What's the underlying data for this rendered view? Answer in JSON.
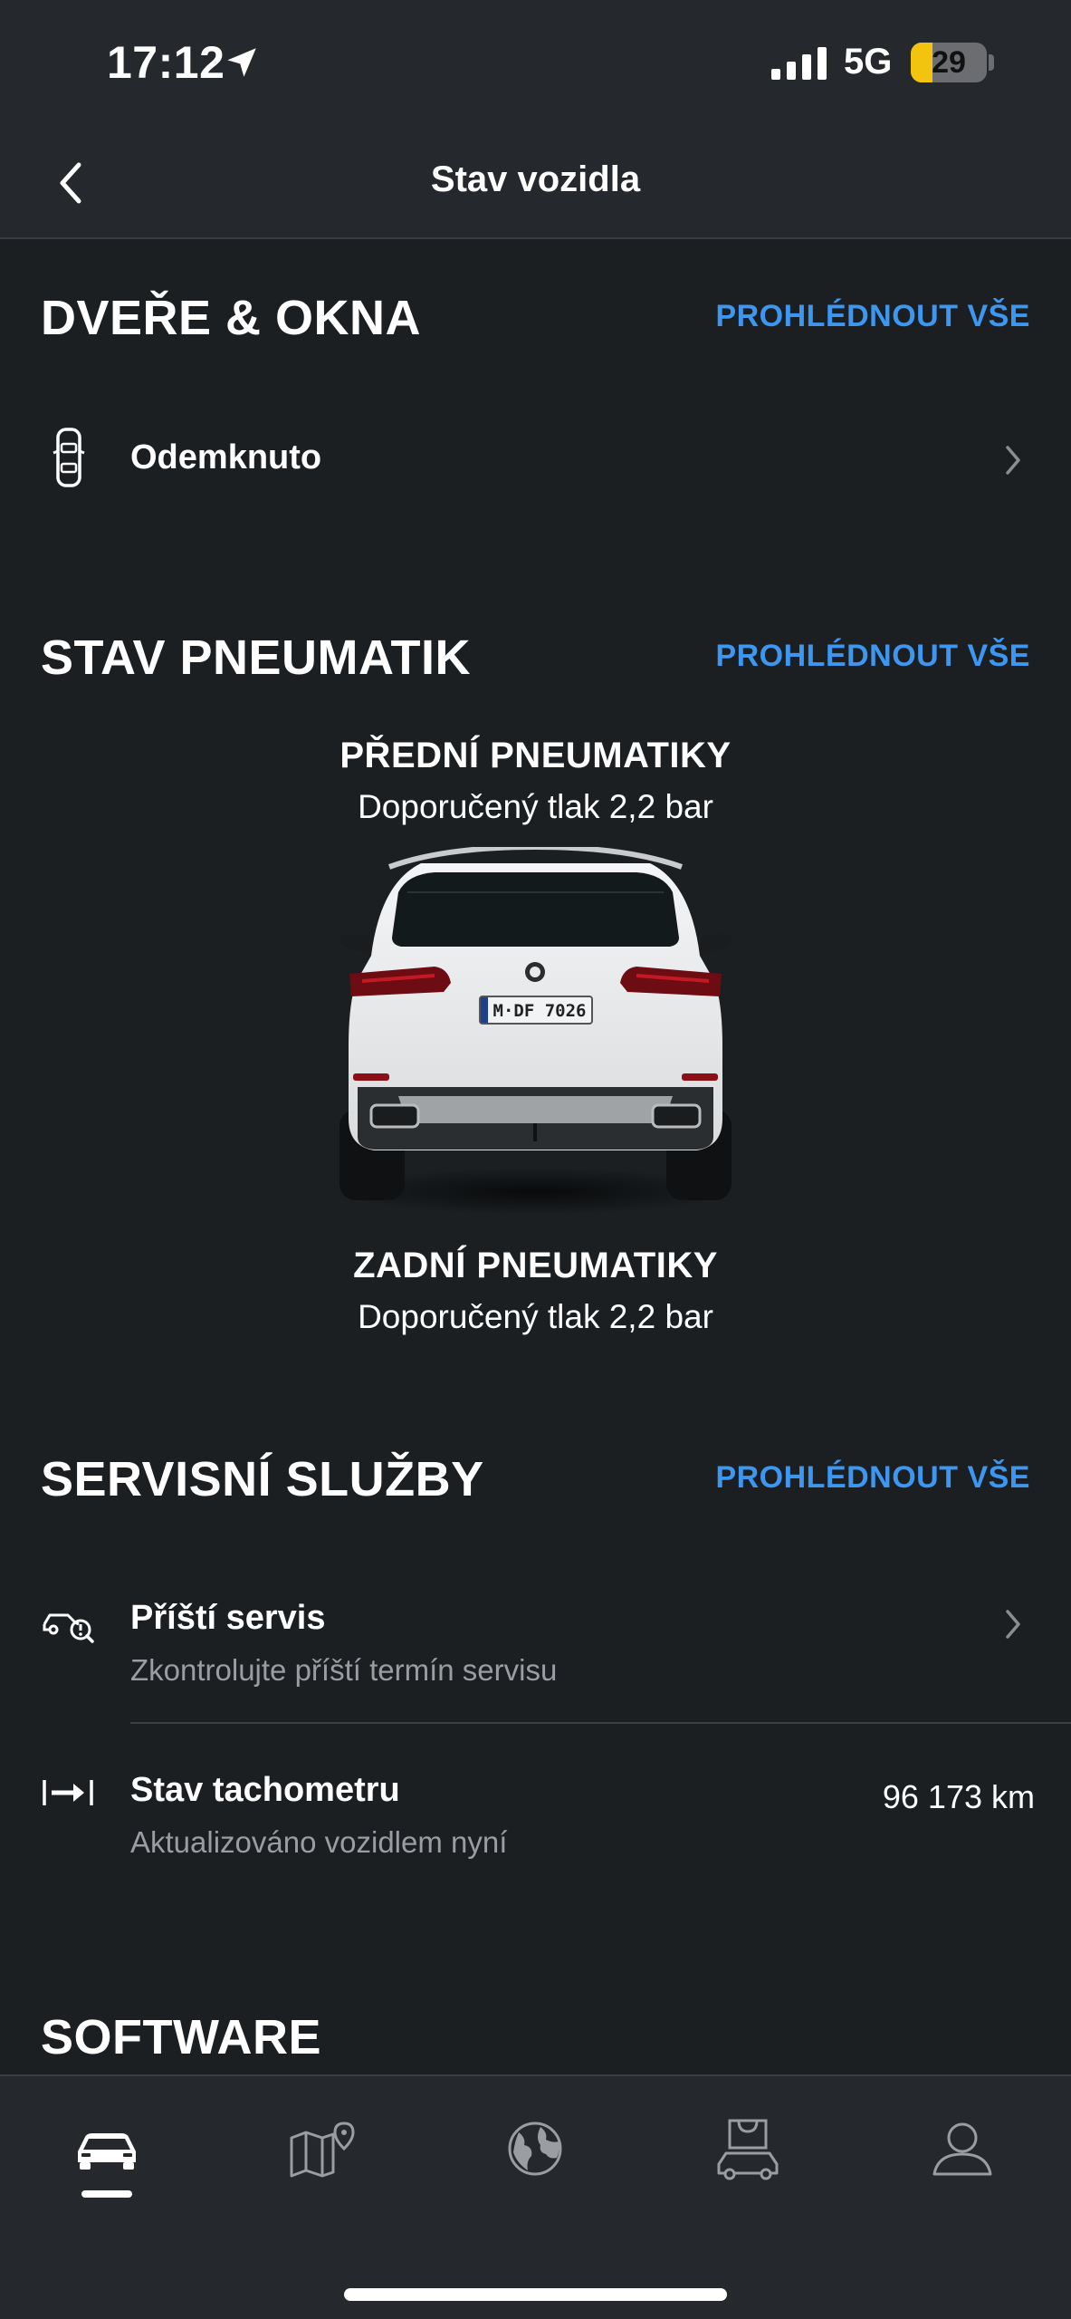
{
  "status_bar": {
    "time": "17:12",
    "network": "5G",
    "battery": 29
  },
  "nav": {
    "title": "Stav vozidla"
  },
  "doors": {
    "title": "DVEŘE & OKNA",
    "view_all": "PROHLÉDNOUT VŠE",
    "status": "Odemknuto"
  },
  "tires": {
    "title": "STAV PNEUMATIK",
    "view_all": "PROHLÉDNOUT VŠE",
    "front_title": "PŘEDNÍ PNEUMATIKY",
    "front_pressure": "Doporučený tlak 2,2 bar",
    "rear_title": "ZADNÍ PNEUMATIKY",
    "rear_pressure": "Doporučený tlak 2,2 bar",
    "plate": "M·DF 7026"
  },
  "service": {
    "title": "SERVISNÍ SLUŽBY",
    "view_all": "PROHLÉDNOUT VŠE",
    "next_service_label": "Příští servis",
    "next_service_sub": "Zkontrolujte příští termín servisu",
    "odometer_label": "Stav tachometru",
    "odometer_sub": "Aktualizováno vozidlem nyní",
    "odometer_value": "96 173 km"
  },
  "software": {
    "title": "SOFTWARE"
  },
  "tabs": [
    {
      "icon": "car-icon",
      "active": true
    },
    {
      "icon": "map-icon",
      "active": false
    },
    {
      "icon": "globe-icon",
      "active": false
    },
    {
      "icon": "shop-car-icon",
      "active": false
    },
    {
      "icon": "profile-icon",
      "active": false
    }
  ],
  "colors": {
    "background": "#1b1f22",
    "bar": "#25282c",
    "accent": "#3d96f0",
    "battery": "#f2c40f",
    "muted_text": "#9a9da1"
  }
}
